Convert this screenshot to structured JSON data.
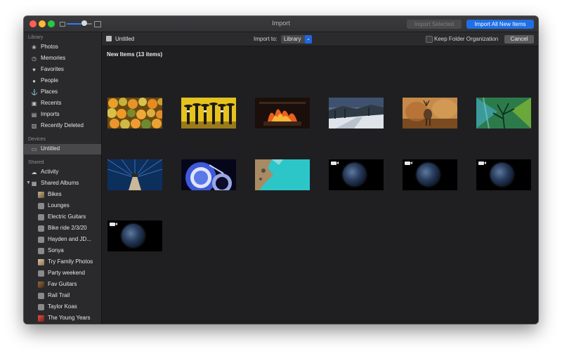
{
  "window": {
    "title": "Import",
    "import_selected_label": "Import Selected",
    "import_all_label": "Import All New Items"
  },
  "sidebar": {
    "library_label": "Library",
    "library_items": [
      {
        "label": "Photos",
        "icon": "photos-icon"
      },
      {
        "label": "Memories",
        "icon": "memories-icon"
      },
      {
        "label": "Favorites",
        "icon": "heart-icon"
      },
      {
        "label": "People",
        "icon": "person-icon"
      },
      {
        "label": "Places",
        "icon": "pin-icon"
      },
      {
        "label": "Recents",
        "icon": "recents-icon"
      },
      {
        "label": "Imports",
        "icon": "imports-icon"
      },
      {
        "label": "Recently Deleted",
        "icon": "trash-icon"
      }
    ],
    "devices_label": "Devices",
    "device_item": {
      "label": "Untitled",
      "icon": "device-icon"
    },
    "shared_label": "Shared",
    "activity_item": {
      "label": "Activity",
      "icon": "cloud-icon"
    },
    "shared_albums_item": {
      "label": "Shared Albums",
      "icon": "shared-albums-icon"
    },
    "albums": [
      "Bikes",
      "Lounges",
      "Electric Guitars",
      "Bike ride 2/3/20",
      "Hayden and JD...",
      "Sonya",
      "Try Family Photos",
      "Party weekend",
      "Fav Guitars",
      "Rail Trail",
      "Taylor Koas",
      "The Young Years"
    ]
  },
  "toolbar": {
    "device_name": "Untitled",
    "import_to_label": "Import to:",
    "import_to_value": "Library",
    "keep_folder_label": "Keep Folder Organization",
    "keep_folder_checked": false,
    "cancel_label": "Cancel"
  },
  "main": {
    "new_items_label": "New Items (13 items)"
  },
  "colors": {
    "accent": "#1f6fe6",
    "window_bg": "#232326",
    "sidebar_bg": "#2a2a2d",
    "main_bg": "#1f1f21"
  }
}
